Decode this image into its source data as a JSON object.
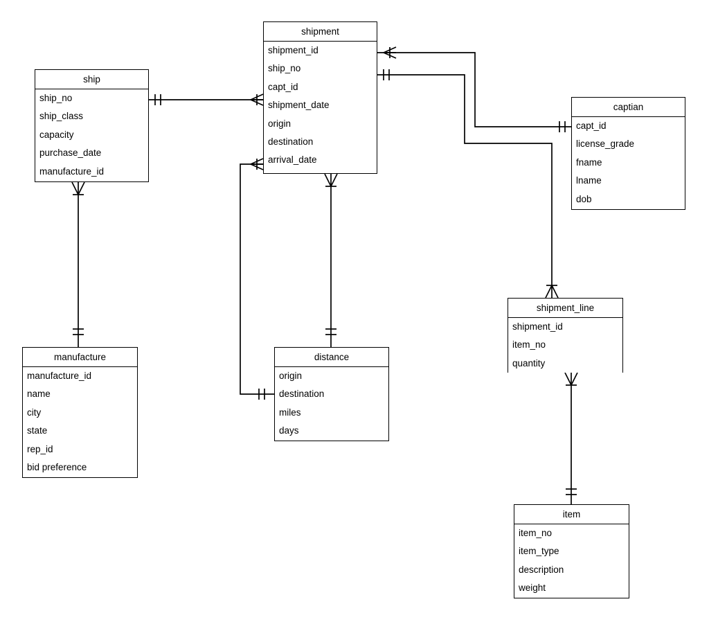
{
  "diagram": {
    "type": "entity-relationship-diagram",
    "notation": "crows-foot",
    "background_color": "#ffffff",
    "line_color": "#000000",
    "text_color": "#000000"
  },
  "entities": [
    {
      "id": "ship",
      "name": "ship",
      "attributes": [
        "ship_no",
        "ship_class",
        "capacity",
        "purchase_date",
        "manufacture_id"
      ]
    },
    {
      "id": "shipment",
      "name": "shipment",
      "attributes": [
        "shipment_id",
        "ship_no",
        "capt_id",
        "shipment_date",
        "origin",
        "destination",
        "arrival_date"
      ]
    },
    {
      "id": "captian",
      "name": "captian",
      "attributes": [
        "capt_id",
        "license_grade",
        "fname",
        "lname",
        "dob"
      ]
    },
    {
      "id": "manufacture",
      "name": "manufacture",
      "attributes": [
        "manufacture_id",
        "name",
        "city",
        "state",
        "rep_id",
        "bid preference"
      ]
    },
    {
      "id": "distance",
      "name": "distance",
      "attributes": [
        "origin",
        "destination",
        "miles",
        "days"
      ]
    },
    {
      "id": "shipment_line",
      "name": "shipment_line",
      "attributes": [
        "shipment_id",
        "item_no",
        "quantity"
      ]
    },
    {
      "id": "item",
      "name": "item",
      "attributes": [
        "item_no",
        "item_type",
        "description",
        "weight"
      ]
    }
  ],
  "relationships": [
    {
      "id": "ship-shipment",
      "from": "ship",
      "to": "shipment",
      "from_cardinality": "one-and-only-one",
      "to_cardinality": "one-to-many"
    },
    {
      "id": "ship-manufacture",
      "from": "ship",
      "to": "manufacture",
      "from_cardinality": "zero-or-many",
      "to_cardinality": "one-and-only-one"
    },
    {
      "id": "shipment-captian",
      "from": "shipment",
      "to": "captian",
      "from_cardinality": "one-to-many",
      "to_cardinality": "one-and-only-one"
    },
    {
      "id": "shipment-shipment_line",
      "from": "shipment",
      "to": "shipment_line",
      "from_cardinality": "one-and-only-one",
      "to_cardinality": "zero-or-many"
    },
    {
      "id": "shipment-distance",
      "from": "shipment",
      "to": "distance",
      "from_cardinality": "zero-or-many",
      "to_cardinality": "one-and-only-one"
    },
    {
      "id": "shipment-distance-origin",
      "from": "shipment",
      "to": "distance",
      "from_cardinality": "one-to-many",
      "to_cardinality": "one-and-only-one"
    },
    {
      "id": "shipment_line-item",
      "from": "shipment_line",
      "to": "item",
      "from_cardinality": "zero-or-many",
      "to_cardinality": "one-and-only-one"
    }
  ]
}
